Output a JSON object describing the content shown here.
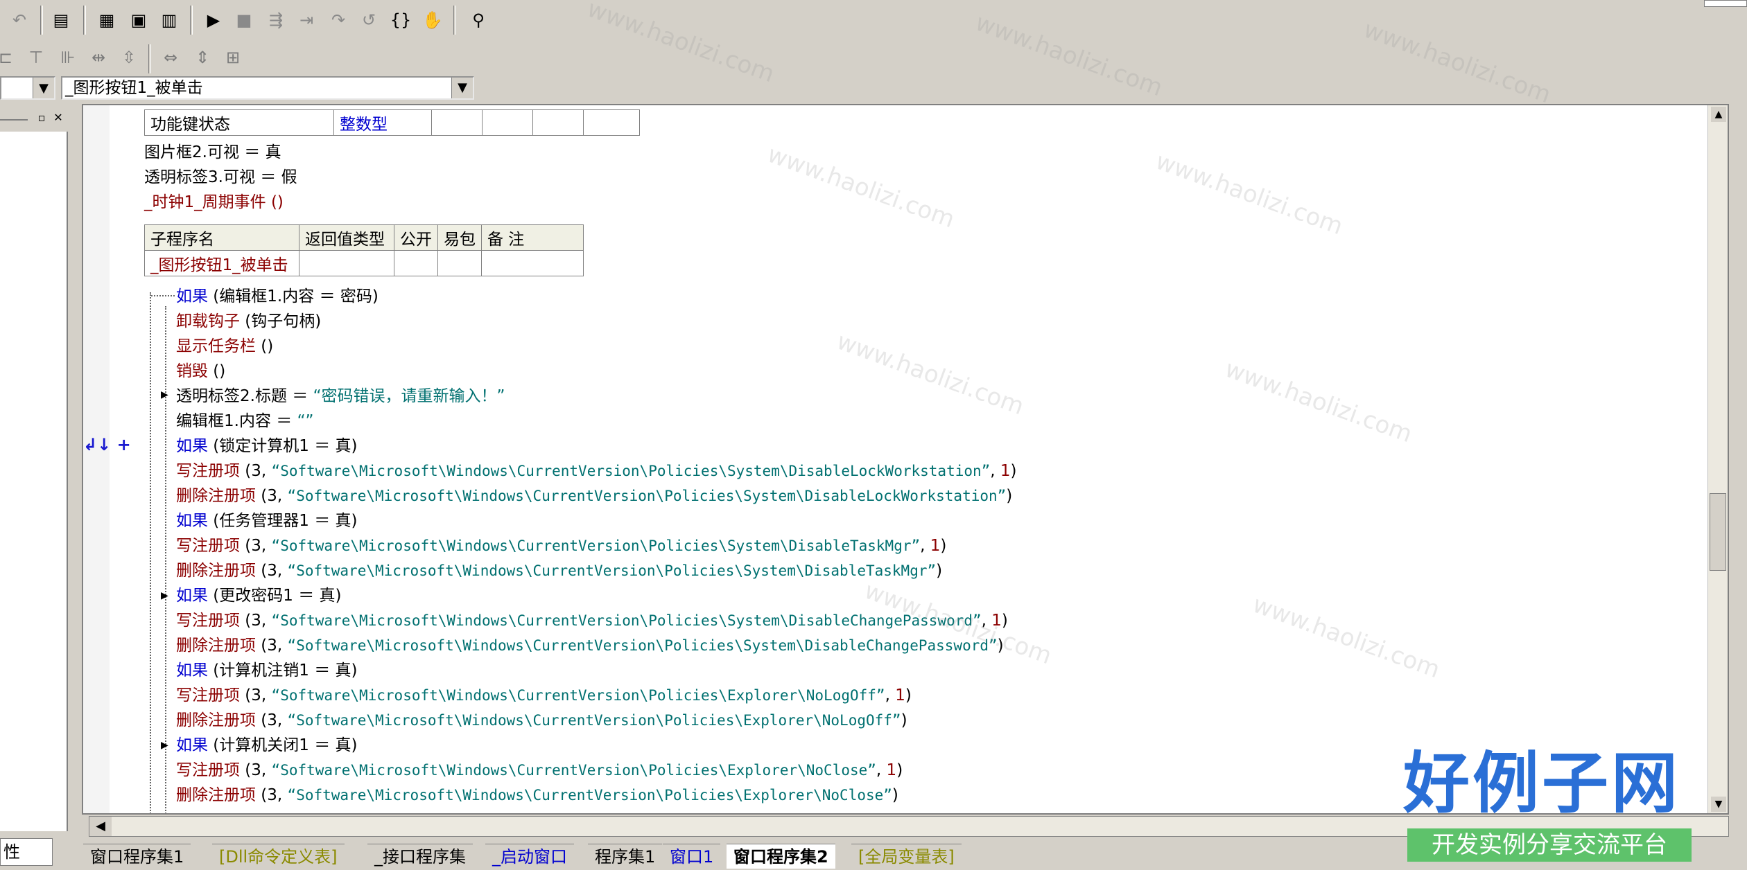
{
  "combo": {
    "selected": "_图形按钮1_被单击"
  },
  "left_panel": {
    "tab_label": "性"
  },
  "table1": {
    "cells": [
      "功能键状态",
      "整数型",
      "",
      "",
      "",
      ""
    ]
  },
  "pre_lines": [
    "图片框2.可视 ＝ 真",
    "透明标签3.可视 ＝ 假",
    "_时钟1_周期事件 ()"
  ],
  "sub_table": {
    "headers": [
      "子程序名",
      "返回值类型",
      "公开",
      "易包",
      "备 注"
    ],
    "row": [
      "_图形按钮1_被单击",
      "",
      "",
      "",
      ""
    ]
  },
  "code": {
    "l1_kw": "如果",
    "l1_rest": " (编辑框1.内容 ＝ 密码)",
    "l2_fn": "卸载钩子",
    "l2_rest": " (钩子句柄)",
    "l3_fn": "显示任务栏",
    "l3_rest": " ()",
    "l4_fn": "销毁",
    "l4_rest": " ()",
    "l5": "透明标签2.标题 ＝ ",
    "l5_str": "“密码错误，请重新输入！”",
    "l6": "编辑框1.内容 ＝ ",
    "l6_str": "“”",
    "l7_kw": "如果",
    "l7_rest": " (锁定计算机1 ＝ 真)",
    "w_fn": "写注册项",
    "d_fn": "删除注册项",
    "arg3": " (3, ",
    "k1": "“Software\\Microsoft\\Windows\\CurrentVersion\\Policies\\System\\DisableLockWorkstation”",
    "l10_rest": " (任务管理器1 ＝ 真)",
    "k2": "“Software\\Microsoft\\Windows\\CurrentVersion\\Policies\\System\\DisableTaskMgr”",
    "l13_rest": " (更改密码1 ＝ 真)",
    "k3": "“Software\\Microsoft\\Windows\\CurrentVersion\\Policies\\System\\DisableChangePassword”",
    "l16_rest": " (计算机注销1 ＝ 真)",
    "k4": "“Software\\Microsoft\\Windows\\CurrentVersion\\Policies\\Explorer\\NoLogOff”",
    "l19_rest": " (计算机关闭1 ＝ 真)",
    "k5": "“Software\\Microsoft\\Windows\\CurrentVersion\\Policies\\Explorer\\NoClose”",
    "comma": ", ",
    "one": "1",
    "close": ")"
  },
  "gutter": {
    "mark": "↲↓ +"
  },
  "tabs": [
    "窗口程序集1",
    "[Dll命令定义表]",
    "_接口程序集",
    "_启动窗口",
    "程序集1",
    "窗口1",
    "窗口程序集2",
    "[全局变量表]"
  ],
  "watermark": {
    "text": "www.haolizi.com",
    "logo": "好例子网",
    "slogan": "开发实例分享交流平台"
  },
  "colors": {
    "keyword": "#0000d0",
    "function": "#8b0000",
    "string": "#007070",
    "logo": "#2a6fd6",
    "slogan_bg": "#5ec26b"
  }
}
